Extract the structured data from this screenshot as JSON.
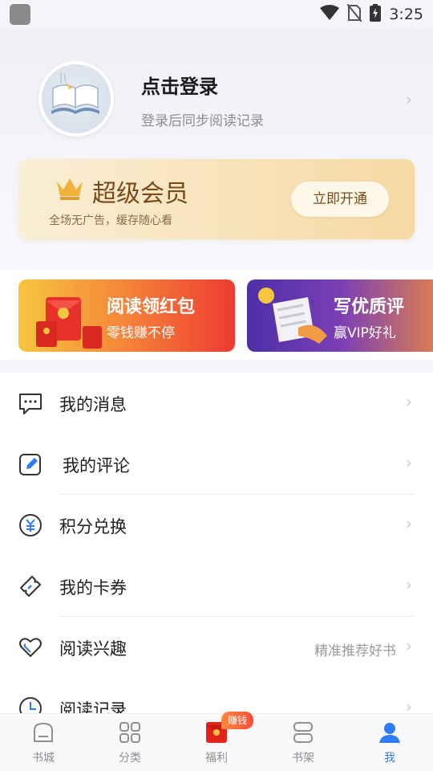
{
  "status_bar": {
    "time": "3:25"
  },
  "profile": {
    "login_title": "点击登录",
    "login_subtitle": "登录后同步阅读记录"
  },
  "vip": {
    "title": "超级会员",
    "subtitle": "全场无广告，缓存随心看",
    "button": "立即开通"
  },
  "banners": [
    {
      "title": "阅读领红包",
      "subtitle": "零钱赚不停"
    },
    {
      "title": "写优质评",
      "subtitle": "赢VIP好礼"
    }
  ],
  "menu": [
    {
      "label": "我的消息",
      "icon": "message-icon"
    },
    {
      "label": "我的评论",
      "icon": "edit-comment-icon"
    },
    {
      "label": "积分兑换",
      "icon": "yuan-coin-icon"
    },
    {
      "label": "我的卡券",
      "icon": "ticket-icon"
    },
    {
      "label": "阅读兴趣",
      "icon": "heart-icon",
      "extra": "精准推荐好书"
    },
    {
      "label": "阅读记录",
      "icon": "clock-icon"
    }
  ],
  "tabs": [
    {
      "label": "书城",
      "icon": "bookstore-icon"
    },
    {
      "label": "分类",
      "icon": "category-grid-icon"
    },
    {
      "label": "福利",
      "icon": "red-envelope-icon",
      "badge": "赚钱"
    },
    {
      "label": "书架",
      "icon": "bookshelf-icon"
    },
    {
      "label": "我",
      "icon": "user-icon",
      "active": true
    }
  ],
  "colors": {
    "accent": "#2f7df6",
    "vip_text": "#7a4a18",
    "tab_inactive": "#8e8e93"
  }
}
